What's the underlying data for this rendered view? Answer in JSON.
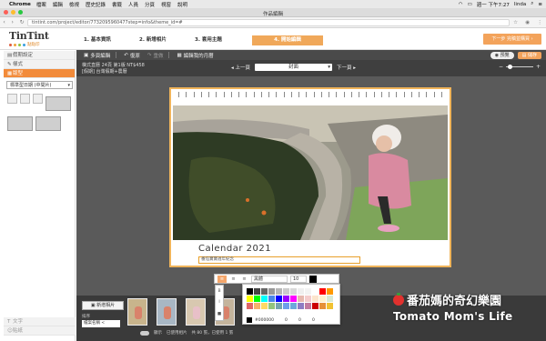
{
  "menubar": {
    "app": "Chrome",
    "items": [
      "檔案",
      "編輯",
      "檢視",
      "歷史記錄",
      "書籤",
      "人員",
      "分頁",
      "視窗",
      "說明"
    ],
    "clock": "週一 下午7:27",
    "user": "linda"
  },
  "window": {
    "title": "作品編輯"
  },
  "address": {
    "url": "tintint.com/project/editor/7732095960477step=info&theme_id=#"
  },
  "header": {
    "logo": "TinTint",
    "logo_sub": "點點印",
    "steps": [
      "1. 基本資訊",
      "2. 新增相片",
      "3. 套用主題",
      "4. 開始編輯"
    ],
    "next_button": "下一步 完稿並購買 ›"
  },
  "sidebar": {
    "items": [
      "假期設定",
      "樣式",
      "版型"
    ],
    "select_value": "標準型日期 (中間片)",
    "bottom_items": [
      "文字",
      "貼紙"
    ]
  },
  "toolbar": {
    "items": [
      "多頁編輯",
      "復原",
      "重做",
      "編輯我的月曆"
    ],
    "preview": "預覽",
    "save": "儲存"
  },
  "infobar": {
    "line1": "橫式直曆 24頁 第1版 NT$458",
    "line2": "[假期] 台灣假期+農曆",
    "prev": "上一頁",
    "page_select": "封面",
    "next": "下一頁"
  },
  "calendar": {
    "title": "Calendar  2021",
    "input_text": "番茄寶寶週年紀念"
  },
  "format": {
    "align_active": "≡",
    "font": "黑體",
    "size": "10",
    "hex": "#000000",
    "v1": "0",
    "v2": "0",
    "v3": "0"
  },
  "palette_colors": [
    "#000000",
    "#444444",
    "#666666",
    "#999999",
    "#b7b7b7",
    "#cccccc",
    "#d9d9d9",
    "#efefef",
    "#f3f3f3",
    "#ffffff",
    "#ff0000",
    "#ff9900",
    "#ffff00",
    "#00ff00",
    "#00ffff",
    "#4a86e8",
    "#0000ff",
    "#9900ff",
    "#ff00ff",
    "#e6b8af",
    "#f4cccc",
    "#fce5cd",
    "#fff2cc",
    "#d9ead3",
    "#e06666",
    "#f6b26b",
    "#ffd966",
    "#93c47d",
    "#76a5af",
    "#6d9eeb",
    "#6fa8dc",
    "#8e7cc3",
    "#c27ba0",
    "#cc0000",
    "#e69138",
    "#f1c232"
  ],
  "strip": {
    "add_button": "新增相片",
    "sort_label": "排序",
    "sort_value": "檔案名稱 <",
    "footer_toggle": "顯示",
    "footer_used": "已使用相片",
    "footer_count": "共 80 張，已使用 1 張"
  },
  "watermark": {
    "zh": "番茄媽的奇幻樂園",
    "en": "Tomato Mom's Life"
  },
  "colors": {
    "accent": "#f3a35b",
    "active_tab": "#f28b3a",
    "dark": "#4a4a4a"
  }
}
